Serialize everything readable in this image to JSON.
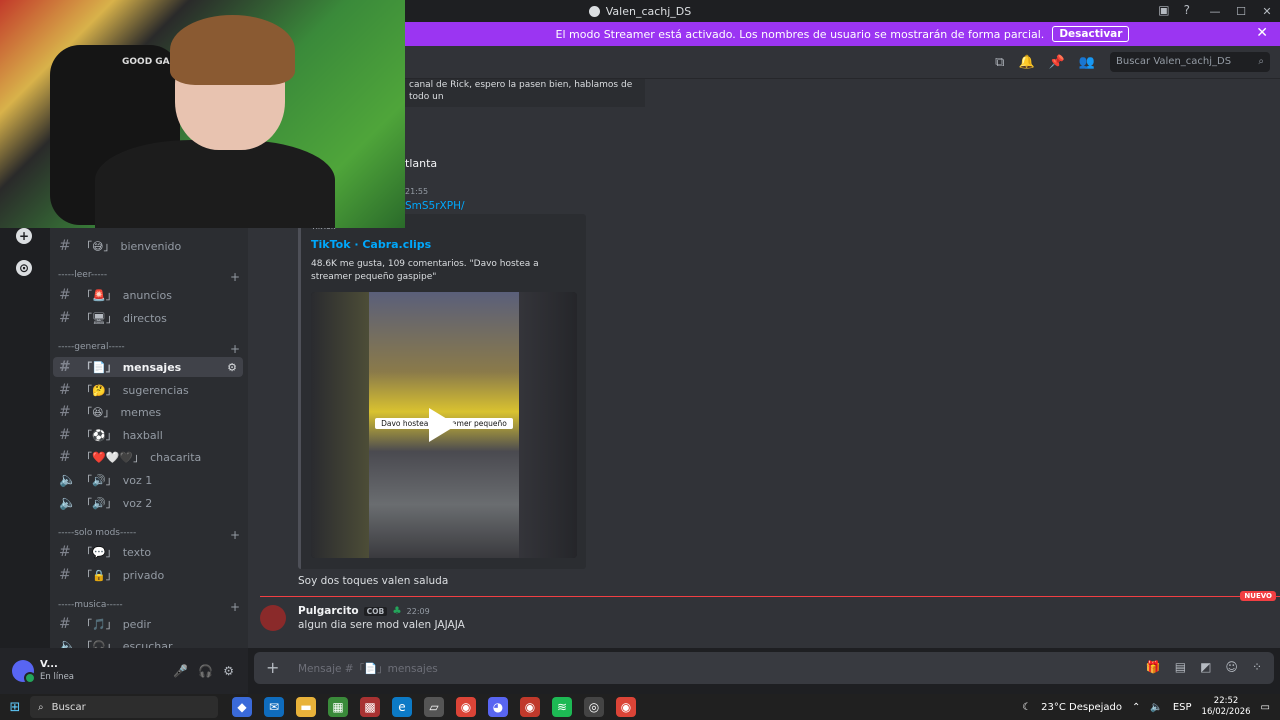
{
  "window": {
    "title": "Valen_cachj_DS"
  },
  "banner": {
    "text": "El modo Streamer está activado. Los nombres de usuario se mostrarán de forma parcial.",
    "button": "Desactivar",
    "color": "#9b35f2"
  },
  "header": {
    "search_placeholder": "Buscar Valen_cachj_DS"
  },
  "channels": {
    "categories": {
      "leer": "-----leer-----",
      "general": "-----general-----",
      "solomods": "-----solo mods-----",
      "musica": "-----musica-----"
    },
    "items": [
      {
        "name": "bienvenido",
        "prefix": "「😅」"
      },
      {
        "name": "anuncios",
        "prefix": "「🚨」"
      },
      {
        "name": "directos",
        "prefix": "「🖥」"
      },
      {
        "name": "mensajes",
        "prefix": "「📄」"
      },
      {
        "name": "sugerencias",
        "prefix": "「🤔」"
      },
      {
        "name": "memes",
        "prefix": "「😆」"
      },
      {
        "name": "haxball",
        "prefix": "「⚽」"
      },
      {
        "name": "chacarita",
        "prefix": "「❤️🤍🖤」"
      },
      {
        "name": "voz 1",
        "prefix": "「🔊」"
      },
      {
        "name": "voz 2",
        "prefix": "「🔊」"
      },
      {
        "name": "texto",
        "prefix": "「💬」"
      },
      {
        "name": "privado",
        "prefix": "「🔒」"
      },
      {
        "name": "pedir",
        "prefix": "「🎵」"
      },
      {
        "name": "escuchar",
        "prefix": "「🎧」"
      }
    ]
  },
  "user": {
    "name": "V...",
    "status": "En línea"
  },
  "messages": {
    "frag_text": "canal de Rick, espero la pasen bien, hablamos de todo un",
    "atlanta": "tlanta",
    "time1": "21:55",
    "link": "SmS5rXPH/",
    "embed": {
      "provider": "TikTok",
      "title": "TikTok · Cabra.clips",
      "description": "48.6K me gusta, 109 comentarios. \"Davo hostea a streamer pequeño gaspipe\"",
      "caption": "Davo hostea a streamer pequeño"
    },
    "after_embed": "Soy dos toques valen saluda",
    "new_badge": "NUEVO",
    "last": {
      "username": "Pulgarcito",
      "tag": "COB",
      "time": "22:09",
      "text": "algun dia sere mod valen JAJAJA"
    }
  },
  "composer": {
    "placeholder": "Mensaje #「📄」mensajes"
  },
  "webcam": {
    "chair_label": "GOOD GAME"
  },
  "taskbar": {
    "search": "Buscar",
    "weather": "23°C  Despejado",
    "lang": "ESP",
    "time": "22:52",
    "date": "16/02/2026"
  }
}
